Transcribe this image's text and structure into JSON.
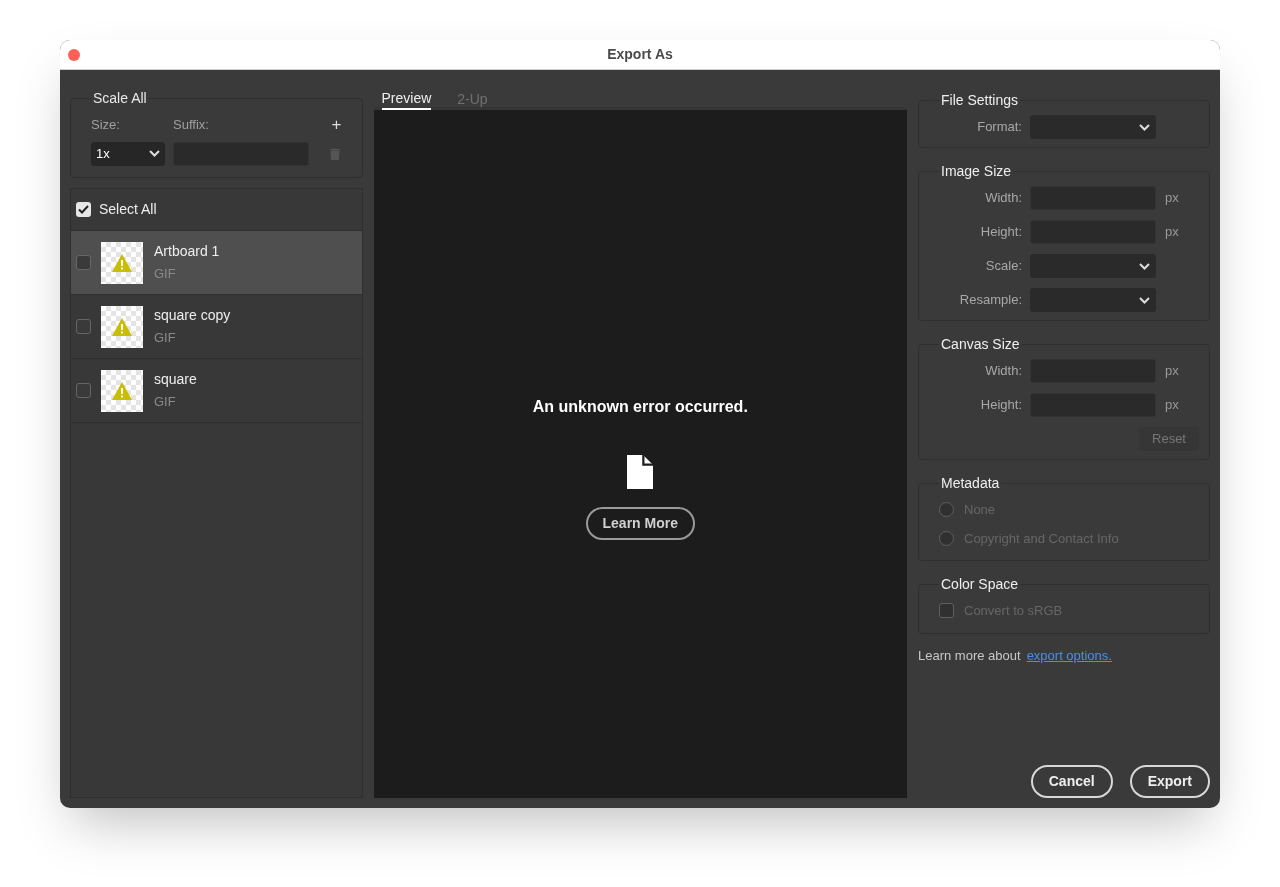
{
  "window": {
    "title": "Export As"
  },
  "scale_all": {
    "title": "Scale All",
    "size_label": "Size:",
    "suffix_label": "Suffix:",
    "size_value": "1x",
    "add_icon": "+"
  },
  "select_all": {
    "label": "Select All",
    "checked": true
  },
  "assets": [
    {
      "name": "Artboard 1",
      "format": "GIF",
      "checked": false,
      "selected": true
    },
    {
      "name": "square copy",
      "format": "GIF",
      "checked": false,
      "selected": false
    },
    {
      "name": "square",
      "format": "GIF",
      "checked": false,
      "selected": false
    }
  ],
  "tabs": [
    {
      "label": "Preview",
      "selected": true,
      "disabled": false
    },
    {
      "label": "2-Up",
      "selected": false,
      "disabled": true
    }
  ],
  "preview": {
    "message": "An unknown error occurred.",
    "button": "Learn More"
  },
  "sections": [
    {
      "kind": "fields",
      "title": "File Settings",
      "fields": [
        {
          "label": "Format:",
          "kind": "select"
        }
      ]
    },
    {
      "kind": "fields",
      "title": "Image Size",
      "fields": [
        {
          "label": "Width:",
          "kind": "input",
          "unit": "px"
        },
        {
          "label": "Height:",
          "kind": "input",
          "unit": "px"
        },
        {
          "label": "Scale:",
          "kind": "select"
        },
        {
          "label": "Resample:",
          "kind": "select"
        }
      ]
    },
    {
      "kind": "fields",
      "title": "Canvas Size",
      "fields": [
        {
          "label": "Width:",
          "kind": "input",
          "unit": "px"
        },
        {
          "label": "Height:",
          "kind": "input",
          "unit": "px"
        }
      ],
      "button": {
        "label": "Reset",
        "disabled": true
      }
    },
    {
      "kind": "radios",
      "title": "Metadata",
      "options": [
        {
          "label": "None",
          "selected": false,
          "disabled": true
        },
        {
          "label": "Copyright and Contact Info",
          "selected": false,
          "disabled": true
        }
      ]
    },
    {
      "kind": "checkbox",
      "title": "Color Space",
      "checkbox": {
        "label": "Convert to sRGB",
        "checked": false,
        "disabled": true
      }
    }
  ],
  "learn_more": {
    "text": "Learn more about",
    "link": "export options."
  },
  "buttons": [
    {
      "label": "Cancel"
    },
    {
      "label": "Export"
    }
  ]
}
